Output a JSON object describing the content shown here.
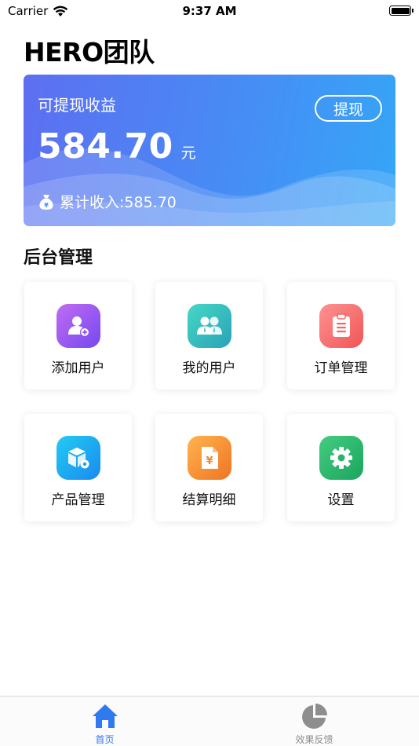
{
  "status_bar": {
    "carrier": "Carrier",
    "time": "9:37 AM",
    "wifi_icon": "wifi-icon",
    "battery_icon": "battery-full-icon"
  },
  "page": {
    "title": "HERO团队"
  },
  "earnings": {
    "label": "可提现收益",
    "amount": "584.70",
    "unit": "元",
    "withdraw_label": "提现",
    "total_text": "累计收入:585.70",
    "total_icon": "money-bag-icon",
    "gradient": [
      "#5d6ff1",
      "#35a6f7"
    ]
  },
  "admin": {
    "title": "后台管理",
    "items": [
      {
        "label": "添加用户",
        "icon": "add-user-icon",
        "color": [
          "#b267f0",
          "#7a4cf0"
        ]
      },
      {
        "label": "我的用户",
        "icon": "users-icon",
        "color": [
          "#3dd4c6",
          "#2aa9b8"
        ]
      },
      {
        "label": "订单管理",
        "icon": "clipboard-icon",
        "color": [
          "#ff8a8a",
          "#f25a5a"
        ]
      },
      {
        "label": "产品管理",
        "icon": "product-box-icon",
        "color": [
          "#20c4f0",
          "#1b8ef0"
        ]
      },
      {
        "label": "结算明细",
        "icon": "settlement-doc-icon",
        "color": [
          "#ffb04a",
          "#f07a2a"
        ]
      },
      {
        "label": "设置",
        "icon": "gear-icon",
        "color": [
          "#3fca7d",
          "#1fa862"
        ]
      }
    ]
  },
  "tab_bar": {
    "tabs": [
      {
        "label": "首页",
        "icon": "home-icon",
        "active": true,
        "color": "#2f7af0"
      },
      {
        "label": "效果反馈",
        "icon": "pie-chart-icon",
        "active": false,
        "color": "#8e8e8e"
      }
    ]
  }
}
